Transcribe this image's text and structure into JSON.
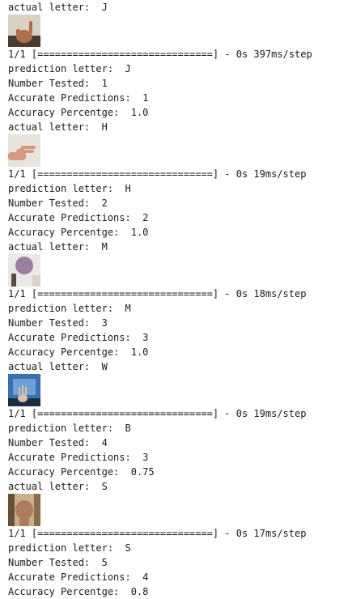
{
  "blocks": [
    {
      "actual": "actual letter:  J",
      "progress": "1/1 [==============================] - 0s 397ms/step",
      "prediction": "prediction letter:  J",
      "tested": "Number Tested:  1",
      "accurate": "Accurate Predictions:  1",
      "accuracy": "Accuracy Percentge:  1.0",
      "thumb": "hand-sign-J",
      "colors": {
        "bg": "#d9d2c4",
        "hand": "#b06d4e"
      }
    },
    {
      "actual": "actual letter:  H",
      "progress": "1/1 [==============================] - 0s 19ms/step",
      "prediction": "prediction letter:  H",
      "tested": "Number Tested:  2",
      "accurate": "Accurate Predictions:  2",
      "accuracy": "Accuracy Percentge:  1.0",
      "thumb": "hand-sign-H",
      "colors": {
        "bg": "#e8e4dc",
        "hand": "#d49a83"
      }
    },
    {
      "actual": "actual letter:  M",
      "progress": "1/1 [==============================] - 0s 18ms/step",
      "prediction": "prediction letter:  M",
      "tested": "Number Tested:  3",
      "accurate": "Accurate Predictions:  3",
      "accuracy": "Accuracy Percentge:  1.0",
      "thumb": "hand-sign-M",
      "colors": {
        "bg": "#ece8e6",
        "hand": "#9c7fa0"
      }
    },
    {
      "actual": "actual letter:  W",
      "progress": "1/1 [==============================] - 0s 19ms/step",
      "prediction": "prediction letter:  B",
      "tested": "Number Tested:  4",
      "accurate": "Accurate Predictions:  3",
      "accuracy": "Accuracy Percentge:  0.75",
      "thumb": "hand-sign-W",
      "colors": {
        "bg": "#3b6fb0",
        "hand": "#e2c2a8"
      }
    },
    {
      "actual": "actual letter:  S",
      "progress": "1/1 [==============================] - 0s 17ms/step",
      "prediction": "prediction letter:  S",
      "tested": "Number Tested:  5",
      "accurate": "Accurate Predictions:  4",
      "accuracy": "Accuracy Percentge:  0.8",
      "thumb": "hand-sign-S",
      "colors": {
        "bg": "#c8b08c",
        "hand": "#b07a5c"
      }
    }
  ]
}
